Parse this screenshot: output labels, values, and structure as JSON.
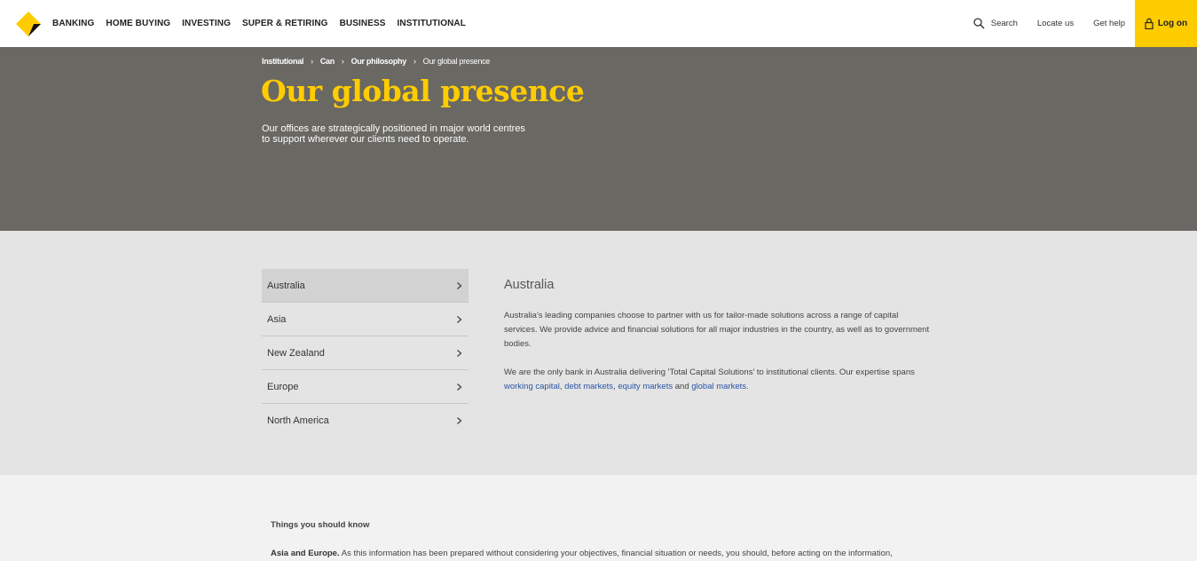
{
  "header": {
    "nav": [
      "BANKING",
      "HOME BUYING",
      "INVESTING",
      "SUPER & RETIRING",
      "BUSINESS",
      "INSTITUTIONAL"
    ],
    "search_label": "Search",
    "locate_label": "Locate us",
    "help_label": "Get help",
    "logon_label": "Log on",
    "brand_color": "#ffcc00"
  },
  "hero": {
    "breadcrumbs": [
      "Institutional",
      "Can",
      "Our philosophy",
      "Our global presence"
    ],
    "title": "Our global presence",
    "intro_line1": "Our offices are strategically positioned in major world centres",
    "intro_line2": "to support wherever our clients need to operate."
  },
  "regions": {
    "items": [
      "Australia",
      "Asia",
      "New Zealand",
      "Europe",
      "North America"
    ],
    "selected": "Australia"
  },
  "panel": {
    "title": "Australia",
    "para1": "Australia's leading companies choose to partner with us for tailor-made solutions across a range of capital services. We provide advice and financial solutions for all major industries in the country, as well as to government bodies.",
    "para2_prefix": "We are the only bank in Australia delivering 'Total Capital Solutions' to institutional clients. Our expertise spans",
    "links": [
      "working capital",
      "debt markets",
      "equity markets",
      "global markets"
    ],
    "and": "and"
  },
  "footer": {
    "heading": "Things you should know",
    "bold_lead": "Asia and Europe.",
    "text": "As this information has been prepared without considering your objectives, financial situation or needs, you should, before acting on the information,"
  }
}
